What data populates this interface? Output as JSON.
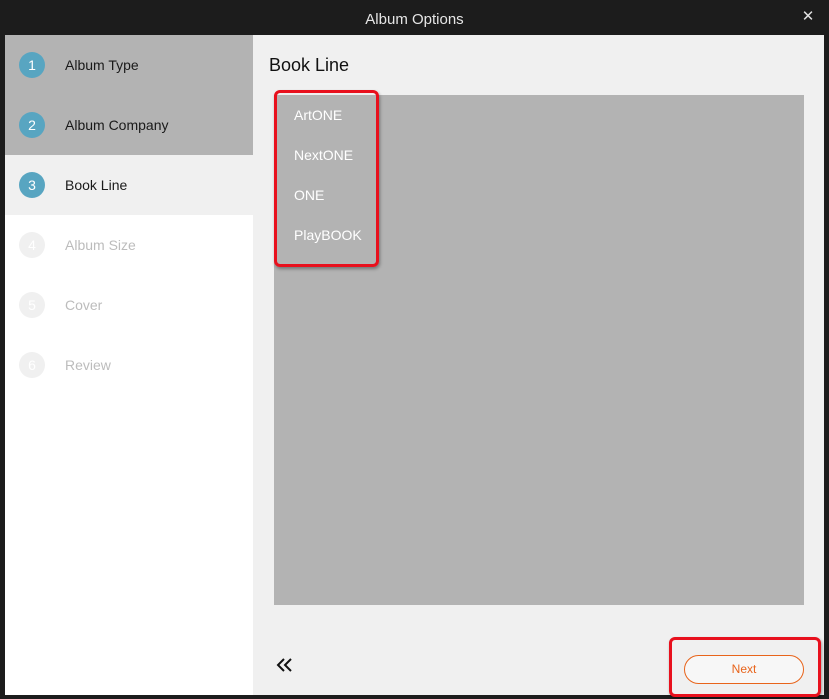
{
  "window": {
    "title": "Album Options",
    "close_glyph": "✕"
  },
  "steps": [
    {
      "number": "1",
      "label": "Album Type",
      "state": "done"
    },
    {
      "number": "2",
      "label": "Album Company",
      "state": "done"
    },
    {
      "number": "3",
      "label": "Book Line",
      "state": "active"
    },
    {
      "number": "4",
      "label": "Album Size",
      "state": "todo"
    },
    {
      "number": "5",
      "label": "Cover",
      "state": "todo"
    },
    {
      "number": "6",
      "label": "Review",
      "state": "todo"
    }
  ],
  "main": {
    "heading": "Book Line",
    "options": [
      "ArtONE",
      "NextONE",
      "ONE",
      "PlayBOOK"
    ]
  },
  "footer": {
    "back_icon": "double-chevron-left-icon",
    "next_label": "Next"
  },
  "colors": {
    "accent": "#58a5c1",
    "next": "#e8641b",
    "highlight": "#e8101d",
    "list_bg": "#b3b3b3"
  }
}
